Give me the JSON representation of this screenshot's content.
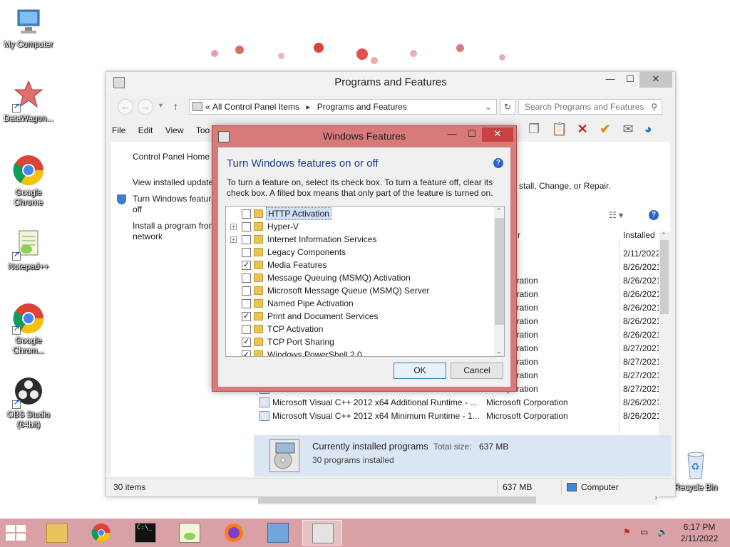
{
  "desktop": {
    "icons": [
      {
        "label": "My Computer"
      },
      {
        "label": "DataWagon..."
      },
      {
        "label": "Google Chrome"
      },
      {
        "label": "Notepad++"
      },
      {
        "label": "Google Chrom..."
      },
      {
        "label": "OBS Studio (64bit)"
      },
      {
        "label": "Recycle Bin"
      }
    ]
  },
  "window": {
    "title": "Programs and Features",
    "address": {
      "part1": "All Control Panel Items",
      "part2": "Programs and Features",
      "chevrons": "«"
    },
    "search_placeholder": "Search Programs and Features",
    "menu": [
      "File",
      "Edit",
      "View",
      "Too"
    ],
    "left_links": {
      "home": "Control Panel Home",
      "view_updates": "View installed update",
      "turn_features_1": "Turn Windows featur",
      "turn_features_2": "off",
      "install_1": "Install a program fron",
      "install_2": "network"
    },
    "right_text": "stall, Change, or Repair.",
    "columns": {
      "publisher": "r",
      "installed": "Installed"
    },
    "rows": [
      {
        "name": "",
        "publisher": "lov",
        "date": "2/11/2022"
      },
      {
        "name": "",
        "publisher": "LLC",
        "date": "8/26/2021"
      },
      {
        "name": "",
        "publisher": "ft Corporation",
        "date": "8/26/2021"
      },
      {
        "name": "",
        "publisher": "ft Corporation",
        "date": "8/26/2021"
      },
      {
        "name": "",
        "publisher": "ft Corporation",
        "date": "8/26/2021"
      },
      {
        "name": "",
        "publisher": "ft Corporation",
        "date": "8/26/2021"
      },
      {
        "name": "",
        "publisher": "ft Corporation",
        "date": "8/26/2021"
      },
      {
        "name": "",
        "publisher": "ft Corporation",
        "date": "8/27/2021"
      },
      {
        "name": "",
        "publisher": "ft Corporation",
        "date": "8/27/2021"
      },
      {
        "name": "",
        "publisher": "ft Corporation",
        "date": "8/27/2021"
      },
      {
        "name": "",
        "publisher": "ft Corporation",
        "date": "8/27/2021"
      },
      {
        "name": "Microsoft Visual C++ 2012 x64 Additional Runtime - ...",
        "publisher": "Microsoft Corporation",
        "date": "8/26/2021"
      },
      {
        "name": "Microsoft Visual C++ 2012 x64 Minimum Runtime - 1...",
        "publisher": "Microsoft Corporation",
        "date": "8/26/2021"
      }
    ],
    "details": {
      "title": "Currently installed programs",
      "total_size_label": "Total size:",
      "total_size_value": "637 MB",
      "count": "30 programs installed"
    },
    "status": {
      "items": "30 items",
      "size": "637 MB",
      "location": "Computer"
    }
  },
  "dialog": {
    "title": "Windows Features",
    "heading": "Turn Windows features on or off",
    "help": "?",
    "description": "To turn a feature on, select its check box. To turn a feature off, clear its check box. A filled box means that only part of the feature is turned on.",
    "features": [
      {
        "label": "HTTP Activation",
        "checked": false,
        "expandable": false,
        "selected": true
      },
      {
        "label": "Hyper-V",
        "checked": false,
        "expandable": true,
        "selected": false
      },
      {
        "label": "Internet Information Services",
        "checked": false,
        "expandable": true,
        "selected": false
      },
      {
        "label": "Legacy Components",
        "checked": false,
        "expandable": false,
        "selected": false
      },
      {
        "label": "Media Features",
        "checked": true,
        "expandable": false,
        "selected": false
      },
      {
        "label": "Message Queuing (MSMQ) Activation",
        "checked": false,
        "expandable": false,
        "selected": false
      },
      {
        "label": "Microsoft Message Queue (MSMQ) Server",
        "checked": false,
        "expandable": false,
        "selected": false
      },
      {
        "label": "Named Pipe Activation",
        "checked": false,
        "expandable": false,
        "selected": false
      },
      {
        "label": "Print and Document Services",
        "checked": true,
        "expandable": false,
        "selected": false
      },
      {
        "label": "TCP Activation",
        "checked": false,
        "expandable": false,
        "selected": false
      },
      {
        "label": "TCP Port Sharing",
        "checked": true,
        "expandable": false,
        "selected": false
      },
      {
        "label": "Windows PowerShell 2.0",
        "checked": true,
        "expandable": false,
        "selected": false
      }
    ],
    "ok": "OK",
    "cancel": "Cancel"
  },
  "taskbar": {
    "time": "6:17 PM",
    "date": "2/11/2022"
  },
  "colors": {
    "taskbar": "#d9a0a5",
    "dialog_frame": "#d87a7a",
    "dialog_close": "#c84141",
    "heading_blue": "#1f3c88"
  }
}
